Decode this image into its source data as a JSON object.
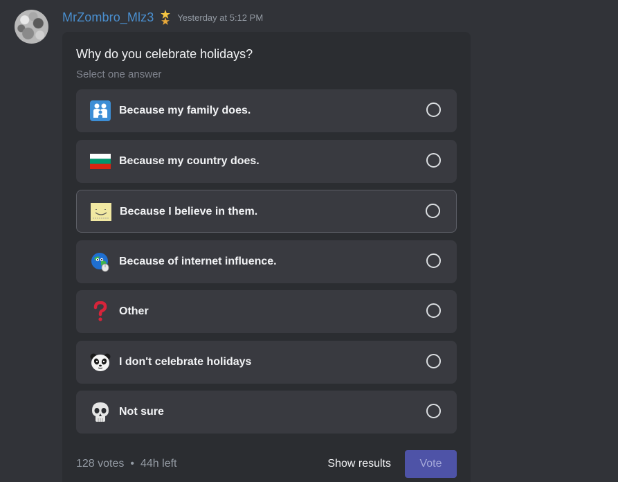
{
  "message": {
    "username": "MrZombro_Mlz3",
    "timestamp": "Yesterday at 5:12 PM",
    "badge_icon": "star-badge-icon",
    "colors": {
      "username": "#4a8fcf",
      "background": "#313338",
      "poll_bg": "#2b2d31"
    }
  },
  "poll": {
    "question": "Why do you celebrate holidays?",
    "hint": "Select one answer",
    "answers": [
      {
        "label": "Because my family does.",
        "emoji": "family-emoji-icon"
      },
      {
        "label": "Because my country does.",
        "emoji": "bulgaria-flag-icon"
      },
      {
        "label": "Because I believe in them.",
        "emoji": "smiley-note-icon"
      },
      {
        "label": "Because of internet influence.",
        "emoji": "globe-mouse-icon"
      },
      {
        "label": "Other",
        "emoji": "red-question-mark-icon"
      },
      {
        "label": "I don't celebrate holidays",
        "emoji": "panda-icon"
      },
      {
        "label": "Not sure",
        "emoji": "skull-icon"
      }
    ],
    "votes": "128 votes",
    "separator": "•",
    "time_left": "44h left",
    "show_results_label": "Show results",
    "vote_label": "Vote",
    "colors": {
      "vote_button": "#4e53a7"
    }
  }
}
